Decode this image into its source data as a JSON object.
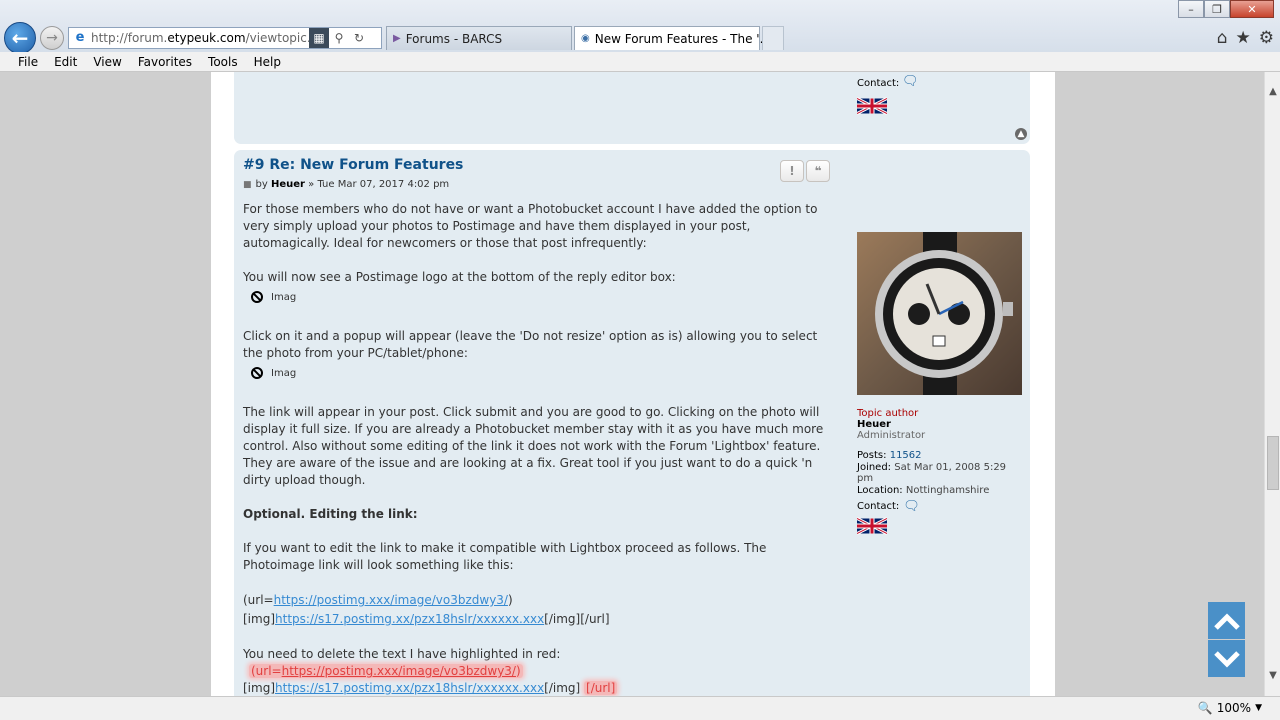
{
  "browser": {
    "url_prefix": "http://forum.",
    "url_domain": "etypeuk.com",
    "url_rest": "/viewtopic.php?f",
    "tabs": [
      {
        "label": "Forums - BARCS"
      },
      {
        "label": "New Forum Features - The '..."
      }
    ],
    "tab_close": "✕"
  },
  "menu": [
    "File",
    "Edit",
    "View",
    "Favorites",
    "Tools",
    "Help"
  ],
  "prev_post": {
    "contact_label": "Contact:"
  },
  "post": {
    "title": "#9 Re: New Forum Features",
    "by": "by",
    "author": "Heuer",
    "date": "» Tue Mar 07, 2017 4:02 pm",
    "report_icon": "!",
    "quote_icon": "❝",
    "paragraphs": {
      "p1": "For those members who do not have or want a Photobucket account I have added the option to very simply upload your photos to Postimage and have them displayed in your post, automagically. Ideal for newcomers or those that post infrequently:",
      "p2": "You will now see a Postimage logo at the bottom of the reply editor box:",
      "img_alt": "Imag",
      "p3": "Click on it and a popup will appear (leave the 'Do not resize' option as is) allowing you to select the photo from your PC/tablet/phone:",
      "p4": "The link will appear in your post. Click submit and you are good to go. Clicking on the photo will display it full size. If you are already a Photobucket member stay with it as you have much more control. Also without some editing of the link it does not work with the Forum 'Lightbox' feature. They are aware of the issue and are looking at a fix. Great tool if you just want to do a quick 'n dirty upload though.",
      "heading": "Optional. Editing the link:",
      "p5": "If you want to edit the link to make it compatible with Lightbox proceed as follows. The Photoimage link will look something like this:",
      "p6": "You need to delete the text I have highlighted in red:"
    },
    "code": {
      "url_open": "(url=",
      "url_link": "https://postimg.xxx/image/vo3bzdwy3/",
      "url_close": ")",
      "img_open": "[img]",
      "img_link": "https://s17.postimg.xx/pzx18hslr/xxxxxx.xxx",
      "img_close": "[/img][/url]",
      "img_close_only": "[/img]",
      "url_end": "[/url]"
    }
  },
  "profile": {
    "rank": "Topic author",
    "name": "Heuer",
    "role": "Administrator",
    "posts_label": "Posts:",
    "posts": "11562",
    "joined_label": "Joined:",
    "joined": "Sat Mar 01, 2008 5:29 pm",
    "location_label": "Location:",
    "location": "Nottinghamshire",
    "contact_label": "Contact:"
  },
  "status": {
    "zoom": "100%"
  },
  "colors": {
    "post_bg": "#e3ecf2",
    "title": "#105289",
    "link": "#368ad2",
    "highlight": "#f4b8b8",
    "scroll_buttons": "#4a90c8"
  }
}
